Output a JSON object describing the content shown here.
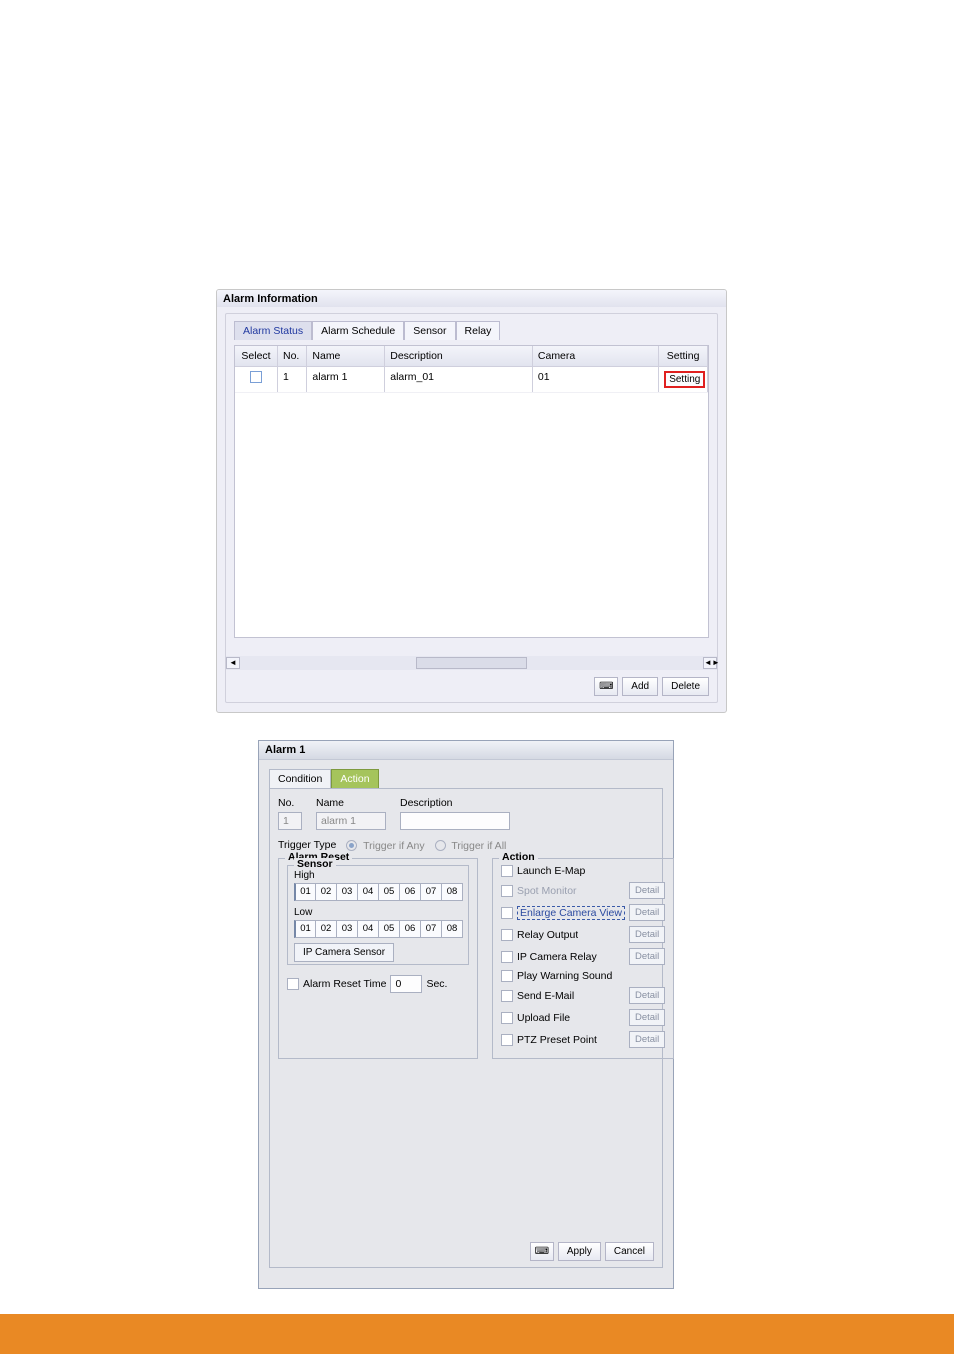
{
  "panel1": {
    "title": "Alarm Information",
    "tabs": [
      "Alarm Status",
      "Alarm Schedule",
      "Sensor",
      "Relay"
    ],
    "active_tab_index": 0,
    "cols": {
      "select": "Select",
      "no": "No.",
      "name": "Name",
      "desc": "Description",
      "camera": "Camera",
      "setting": "Setting"
    },
    "rows": [
      {
        "select_checked": false,
        "no": "1",
        "name": "alarm 1",
        "desc": "alarm_01",
        "camera": "01",
        "setting_btn": "Setting"
      }
    ],
    "buttons": {
      "add": "Add",
      "delete": "Delete"
    }
  },
  "dialog2": {
    "title": "Alarm 1",
    "tabs": {
      "condition": "Condition",
      "action": "Action"
    },
    "fields": {
      "no_lbl": "No.",
      "no": "1",
      "name_lbl": "Name",
      "name": "alarm 1",
      "desc_lbl": "Description",
      "desc": ""
    },
    "trigger": {
      "label": "Trigger Type",
      "any": "Trigger if Any",
      "all": "Trigger if All",
      "selected": "any"
    },
    "alarm_reset_legend": "Alarm Reset",
    "sensor_legend": "Sensor",
    "high_label": "High",
    "low_label": "Low",
    "sensor_high": [
      "01",
      "02",
      "03",
      "04",
      "05",
      "06",
      "07",
      "08"
    ],
    "sensor_low": [
      "01",
      "02",
      "03",
      "04",
      "05",
      "06",
      "07",
      "08"
    ],
    "ip_camera_sensor_btn": "IP Camera Sensor",
    "alarm_reset_time": {
      "checked": false,
      "label": "Alarm Reset Time",
      "value": "0",
      "unit": "Sec."
    },
    "action_legend": "Action",
    "actions": [
      {
        "key": "launch_emap",
        "label": "Launch E-Map",
        "checked": false,
        "detail": false,
        "style": "normal"
      },
      {
        "key": "spot_monitor",
        "label": "Spot Monitor",
        "checked": false,
        "detail": true,
        "style": "grey"
      },
      {
        "key": "enlarge_cam",
        "label": "Enlarge Camera View",
        "checked": false,
        "detail": true,
        "style": "dotted"
      },
      {
        "key": "relay_output",
        "label": "Relay Output",
        "checked": false,
        "detail": true,
        "style": "normal"
      },
      {
        "key": "ipcam_relay",
        "label": "IP Camera Relay",
        "checked": false,
        "detail": true,
        "style": "normal"
      },
      {
        "key": "play_warning",
        "label": "Play Warning Sound",
        "checked": false,
        "detail": false,
        "style": "normal"
      },
      {
        "key": "send_email",
        "label": "Send E-Mail",
        "checked": false,
        "detail": true,
        "style": "normal"
      },
      {
        "key": "upload_file",
        "label": "Upload File",
        "checked": false,
        "detail": true,
        "style": "normal"
      },
      {
        "key": "ptz_preset",
        "label": "PTZ Preset Point",
        "checked": false,
        "detail": true,
        "style": "normal"
      }
    ],
    "detail_btn": "Detail",
    "buttons": {
      "apply": "Apply",
      "cancel": "Cancel"
    }
  }
}
